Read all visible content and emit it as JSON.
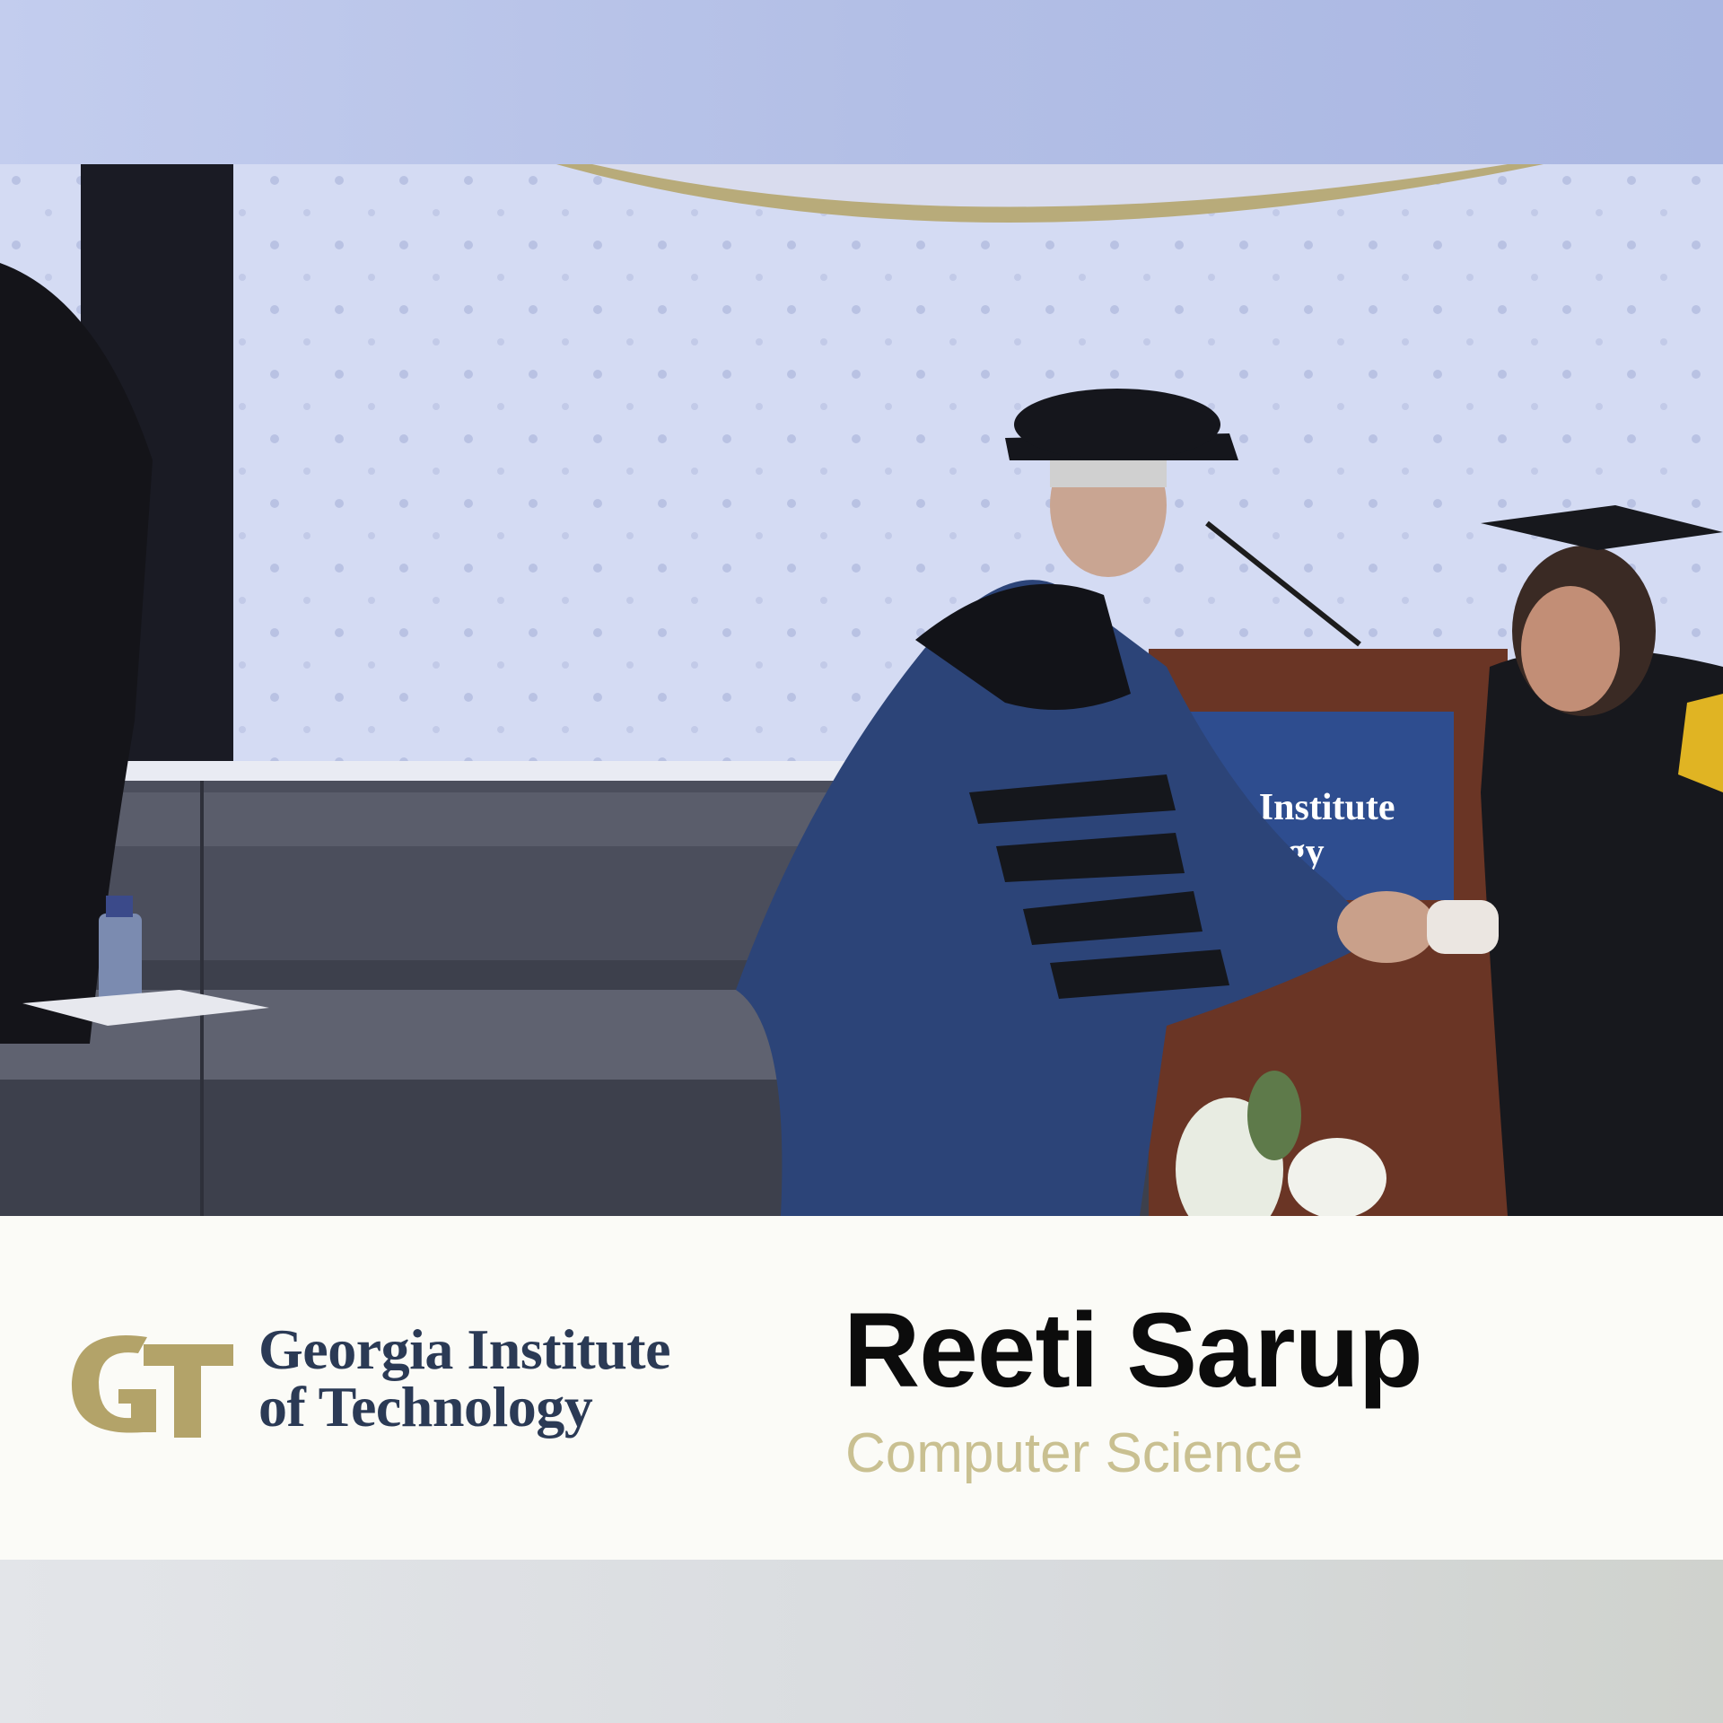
{
  "caption": {
    "institute_line1": "Georgia Institute",
    "institute_line2": "of Technology",
    "graduate_name": "Reeti Sarup",
    "graduate_major": "Computer Science",
    "logo_monogram": "GT"
  },
  "scene": {
    "podium_sign_line1": "rgia Institute",
    "podium_sign_line2": "ology"
  },
  "colors": {
    "gt_gold": "#b3a369",
    "gt_navy": "#2b3a55",
    "major_text": "#c9c091"
  }
}
